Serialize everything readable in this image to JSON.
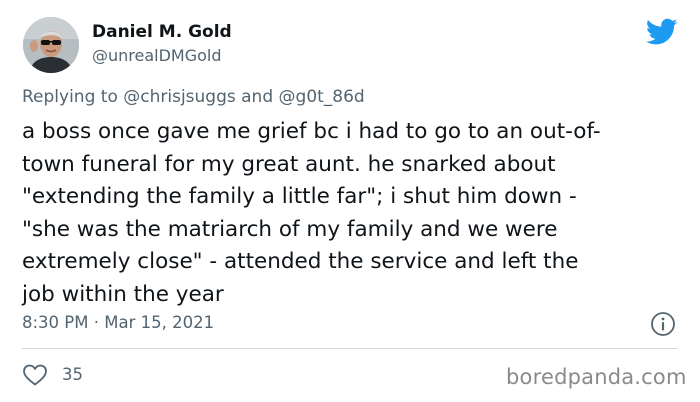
{
  "author": {
    "display_name": "Daniel M. Gold",
    "handle": "@unrealDMGold"
  },
  "reply": {
    "prefix": "Replying to",
    "mention_1": "@chrisjsuggs",
    "joiner": "and",
    "mention_2": "@g0t_86d"
  },
  "body_lines": [
    "a boss once gave me grief bc i had to go to an out-of-",
    "town funeral for my great aunt. he snarked about",
    "\"extending the family a little far\"; i shut him down -",
    "\"she was the matriarch of my family and we were",
    "extremely close\" - attended the service and left the",
    "job within the year"
  ],
  "meta": {
    "timestamp": "8:30 PM · Mar 15, 2021"
  },
  "actions": {
    "like_count": "35"
  },
  "watermark": "boredpanda.com",
  "icons": {
    "brand": "twitter-bird-icon",
    "info": "info-icon",
    "like": "heart-icon"
  },
  "colors": {
    "brand_blue": "#1d9bf0",
    "text_primary": "#0f1419",
    "text_secondary": "#536471",
    "divider": "#cfd9de"
  }
}
